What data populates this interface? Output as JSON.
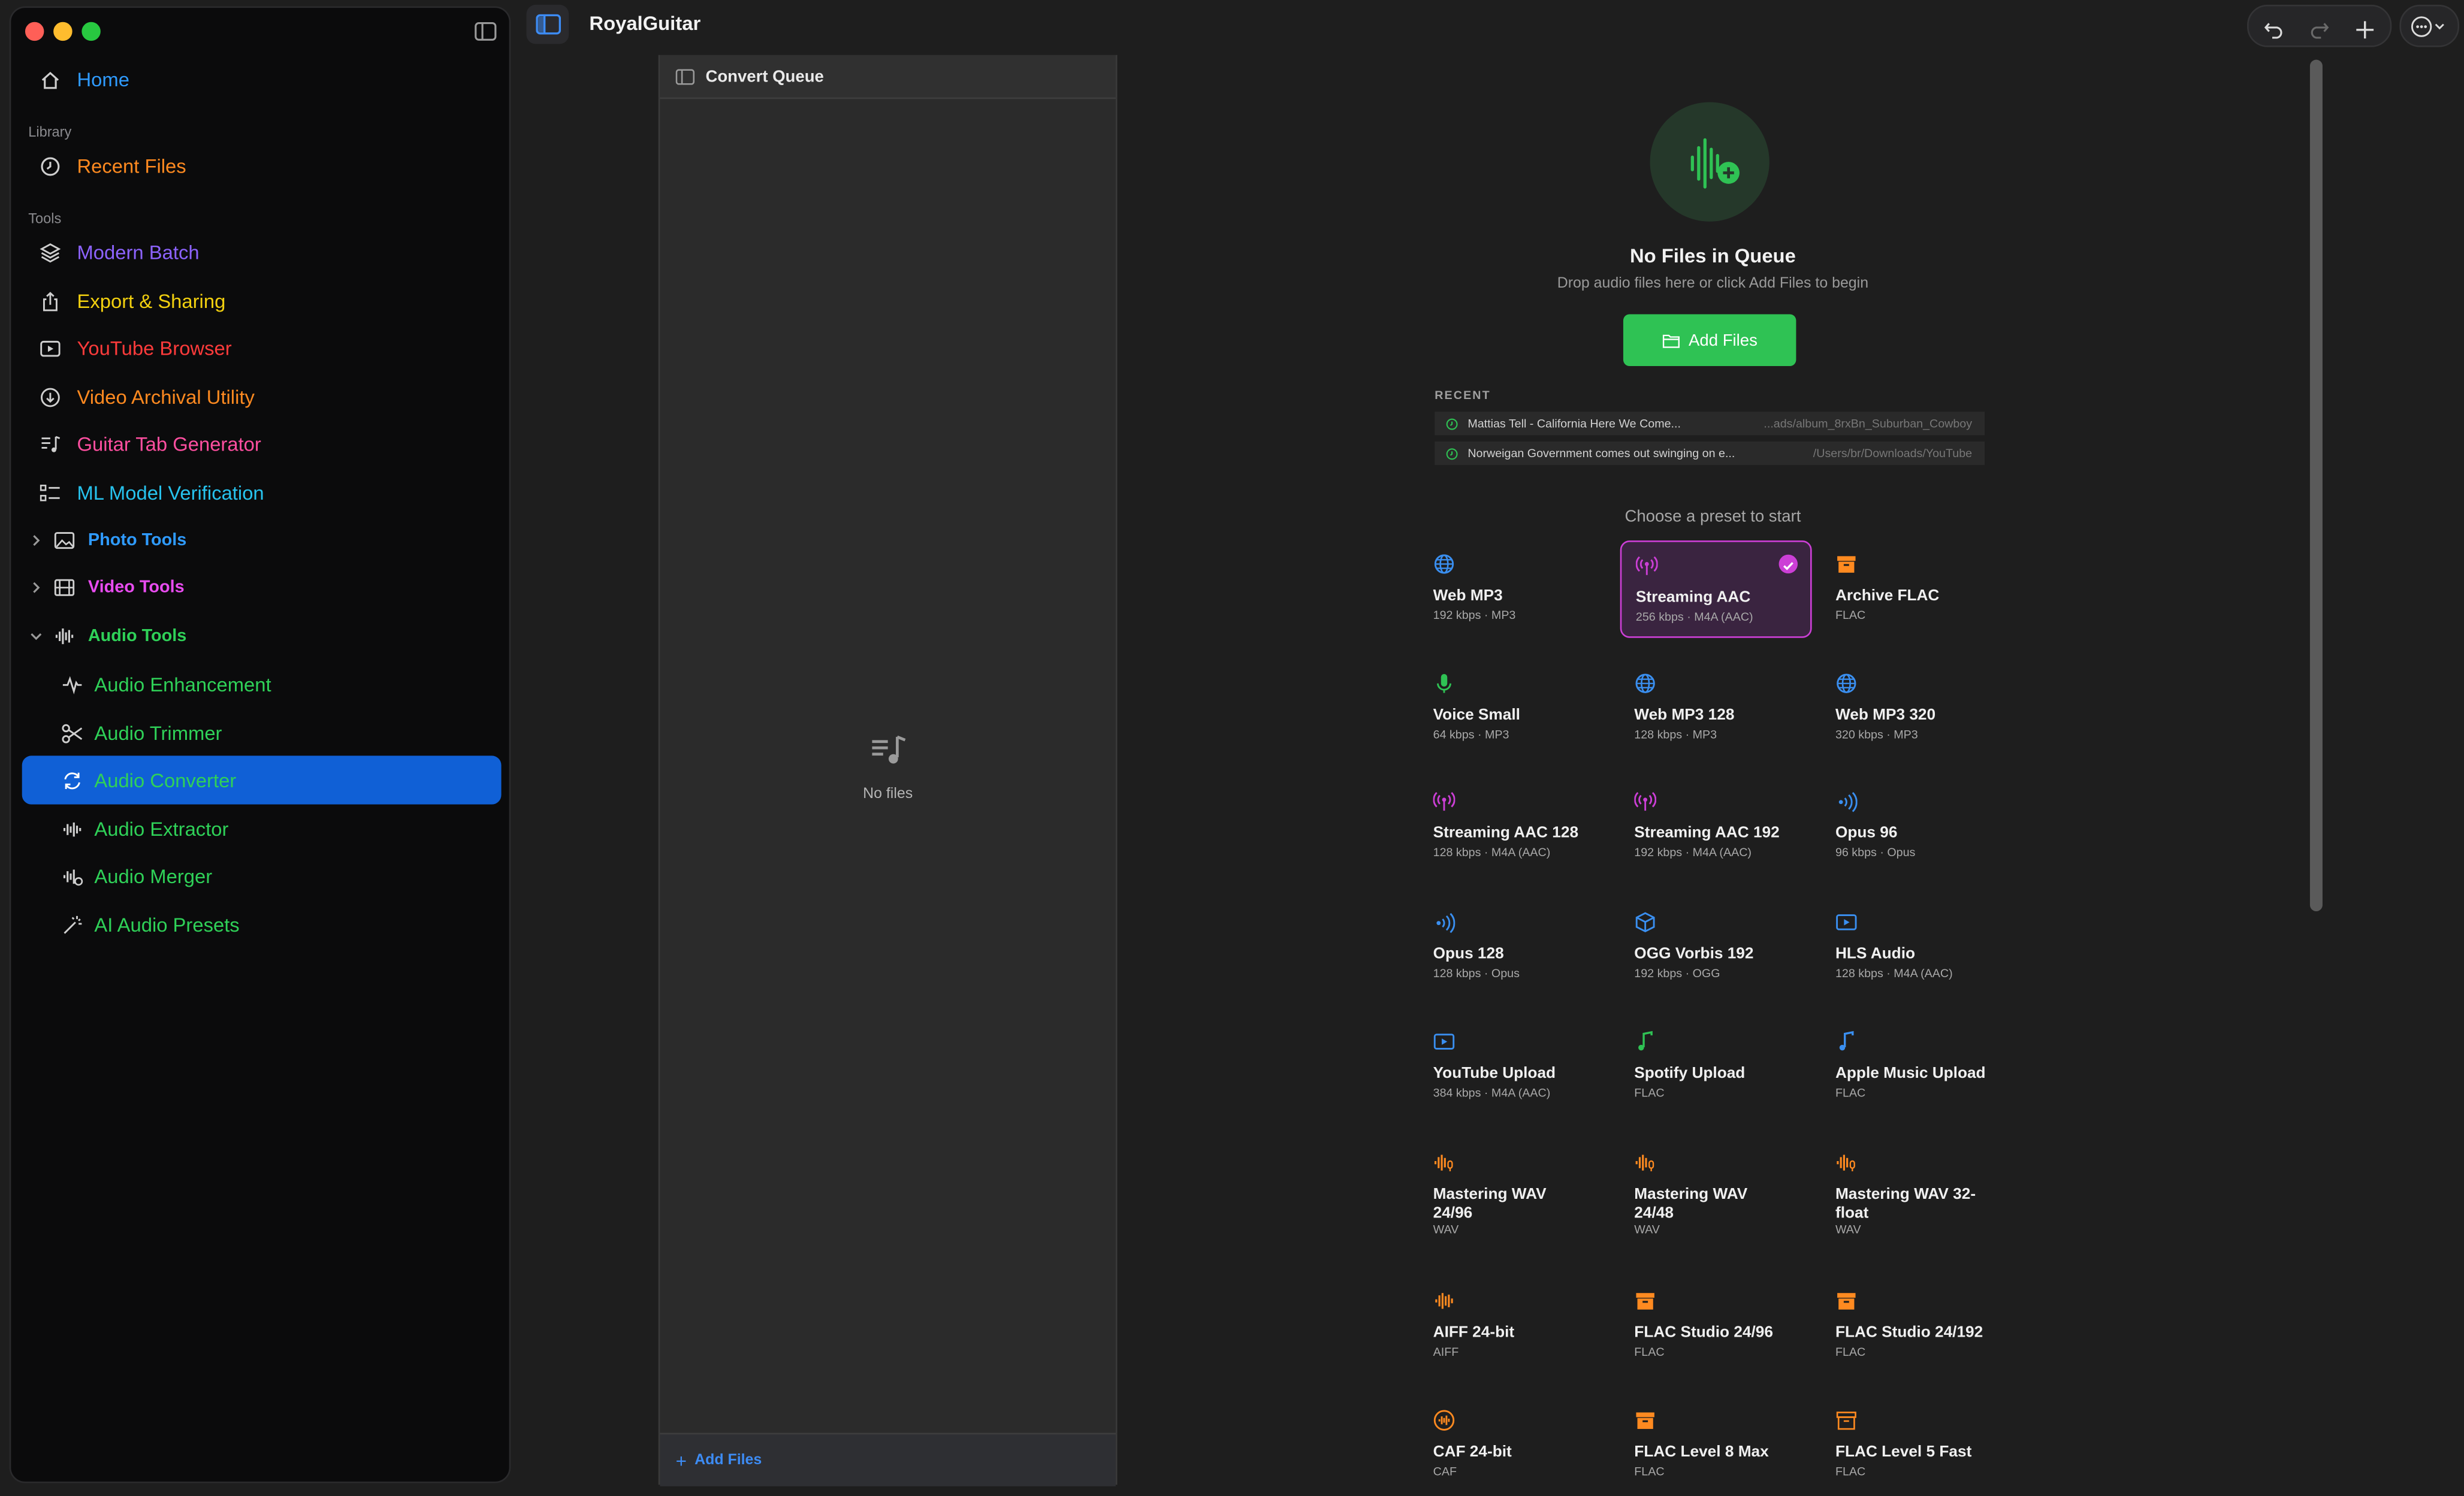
{
  "app": {
    "title": "RoyalGuitar"
  },
  "sidebar": {
    "home": "Home",
    "library_label": "Library",
    "recent_files": "Recent Files",
    "tools_label": "Tools",
    "tools": [
      {
        "label": "Modern Batch",
        "color": "#8d63ff",
        "icon": "layers-icon"
      },
      {
        "label": "Export & Sharing",
        "color": "#f2d00f",
        "icon": "share-icon"
      },
      {
        "label": "YouTube Browser",
        "color": "#ff3b3b",
        "icon": "play-rectangle-icon"
      },
      {
        "label": "Video Archival Utility",
        "color": "#ff8a20",
        "icon": "download-circle-icon"
      },
      {
        "label": "Guitar Tab Generator",
        "color": "#ff4fa0",
        "icon": "music-list-icon"
      },
      {
        "label": "ML Model Verification",
        "color": "#27c3ee",
        "icon": "checklist-icon"
      }
    ],
    "groups": {
      "photo": "Photo Tools",
      "video": "Video Tools",
      "audio": "Audio Tools"
    },
    "audio_items": [
      {
        "label": "Audio Enhancement",
        "icon": "waveform-path-icon"
      },
      {
        "label": "Audio Trimmer",
        "icon": "scissors-icon"
      },
      {
        "label": "Audio Converter",
        "icon": "refresh-icon"
      },
      {
        "label": "Audio Extractor",
        "icon": "waveform-icon"
      },
      {
        "label": "Audio Merger",
        "icon": "waveform-merge-icon"
      },
      {
        "label": "AI Audio Presets",
        "icon": "magic-wand-icon"
      }
    ],
    "selected": "Audio Converter"
  },
  "queue": {
    "title": "Convert Queue",
    "empty_label": "No files",
    "add_files": "Add Files"
  },
  "main": {
    "empty_title": "No Files in Queue",
    "empty_subtitle": "Drop audio files here or click Add Files to begin",
    "add_files_button": "Add Files",
    "recent_label": "RECENT",
    "recent": [
      {
        "name": "Mattias Tell - California Here We Come...",
        "path": "...ads/album_8rxBn_Suburban_Cowboy"
      },
      {
        "name": "Norweigan Government comes out swinging on e...",
        "path": "/Users/br/Downloads/YouTube"
      }
    ],
    "choose_preset": "Choose a preset to start",
    "presets": [
      {
        "name": "Web MP3",
        "detail": "192 kbps · MP3",
        "icon": "globe-icon",
        "color": "#3a8ff0"
      },
      {
        "name": "Streaming AAC",
        "detail": "256 kbps · M4A (AAC)",
        "icon": "antenna-icon",
        "color": "#cc3fd6",
        "selected": true
      },
      {
        "name": "Archive FLAC",
        "detail": "FLAC",
        "icon": "archive-box-icon",
        "color": "#ff8a20"
      },
      {
        "name": "Voice Small",
        "detail": "64 kbps · MP3",
        "icon": "mic-icon",
        "color": "#2fc254"
      },
      {
        "name": "Web MP3 128",
        "detail": "128 kbps · MP3",
        "icon": "globe-icon",
        "color": "#3a8ff0"
      },
      {
        "name": "Web MP3 320",
        "detail": "320 kbps · MP3",
        "icon": "globe-icon",
        "color": "#3a8ff0"
      },
      {
        "name": "Streaming AAC 128",
        "detail": "128 kbps · M4A (AAC)",
        "icon": "antenna-icon",
        "color": "#cc3fd6"
      },
      {
        "name": "Streaming AAC 192",
        "detail": "192 kbps · M4A (AAC)",
        "icon": "antenna-icon",
        "color": "#cc3fd6"
      },
      {
        "name": "Opus 96",
        "detail": "96 kbps · Opus",
        "icon": "sound-waves-icon",
        "color": "#3a8ff0"
      },
      {
        "name": "Opus 128",
        "detail": "128 kbps · Opus",
        "icon": "sound-waves-icon",
        "color": "#3a8ff0"
      },
      {
        "name": "OGG Vorbis 192",
        "detail": "192 kbps · OGG",
        "icon": "cube-icon",
        "color": "#3a8ff0"
      },
      {
        "name": "HLS Audio",
        "detail": "128 kbps · M4A (AAC)",
        "icon": "play-rectangle-icon",
        "color": "#3a8ff0"
      },
      {
        "name": "YouTube Upload",
        "detail": "384 kbps · M4A (AAC)",
        "icon": "play-rectangle-icon",
        "color": "#3a8ff0"
      },
      {
        "name": "Spotify Upload",
        "detail": "FLAC",
        "icon": "music-note-icon",
        "color": "#2fc254"
      },
      {
        "name": "Apple Music Upload",
        "detail": "FLAC",
        "icon": "music-note-icon",
        "color": "#3a8ff0"
      },
      {
        "name": "Mastering WAV 24/96",
        "detail": "WAV",
        "icon": "waveform-mic-icon",
        "color": "#ff8a20",
        "two_line": true
      },
      {
        "name": "Mastering WAV 24/48",
        "detail": "WAV",
        "icon": "waveform-mic-icon",
        "color": "#ff8a20",
        "two_line": true
      },
      {
        "name": "Mastering WAV 32-float",
        "detail": "WAV",
        "icon": "waveform-mic-icon",
        "color": "#ff8a20",
        "two_line": true
      },
      {
        "name": "AIFF 24-bit",
        "detail": "AIFF",
        "icon": "waveform-icon",
        "color": "#ff8a20"
      },
      {
        "name": "FLAC Studio 24/96",
        "detail": "FLAC",
        "icon": "archive-box-icon",
        "color": "#ff8a20"
      },
      {
        "name": "FLAC Studio 24/192",
        "detail": "FLAC",
        "icon": "archive-box-icon",
        "color": "#ff8a20"
      },
      {
        "name": "CAF 24-bit",
        "detail": "CAF",
        "icon": "waveform-circle-icon",
        "color": "#ff8a20"
      },
      {
        "name": "FLAC Level 8 Max",
        "detail": "FLAC",
        "icon": "archive-box-icon",
        "color": "#ff8a20"
      },
      {
        "name": "FLAC Level 5 Fast",
        "detail": "FLAC",
        "icon": "archive-box-outline-icon",
        "color": "#ff8a20"
      }
    ]
  },
  "colors": {
    "home": "#2f9bff",
    "recent": "#ff8a20",
    "photo_group": "#2f9bff",
    "video_group": "#e94cf0",
    "audio_group": "#2fd158",
    "audio_items": "#2fd158",
    "accent_green": "#2fc254",
    "selection": "#1060d6",
    "selected_preset": "#cc3fd6"
  }
}
